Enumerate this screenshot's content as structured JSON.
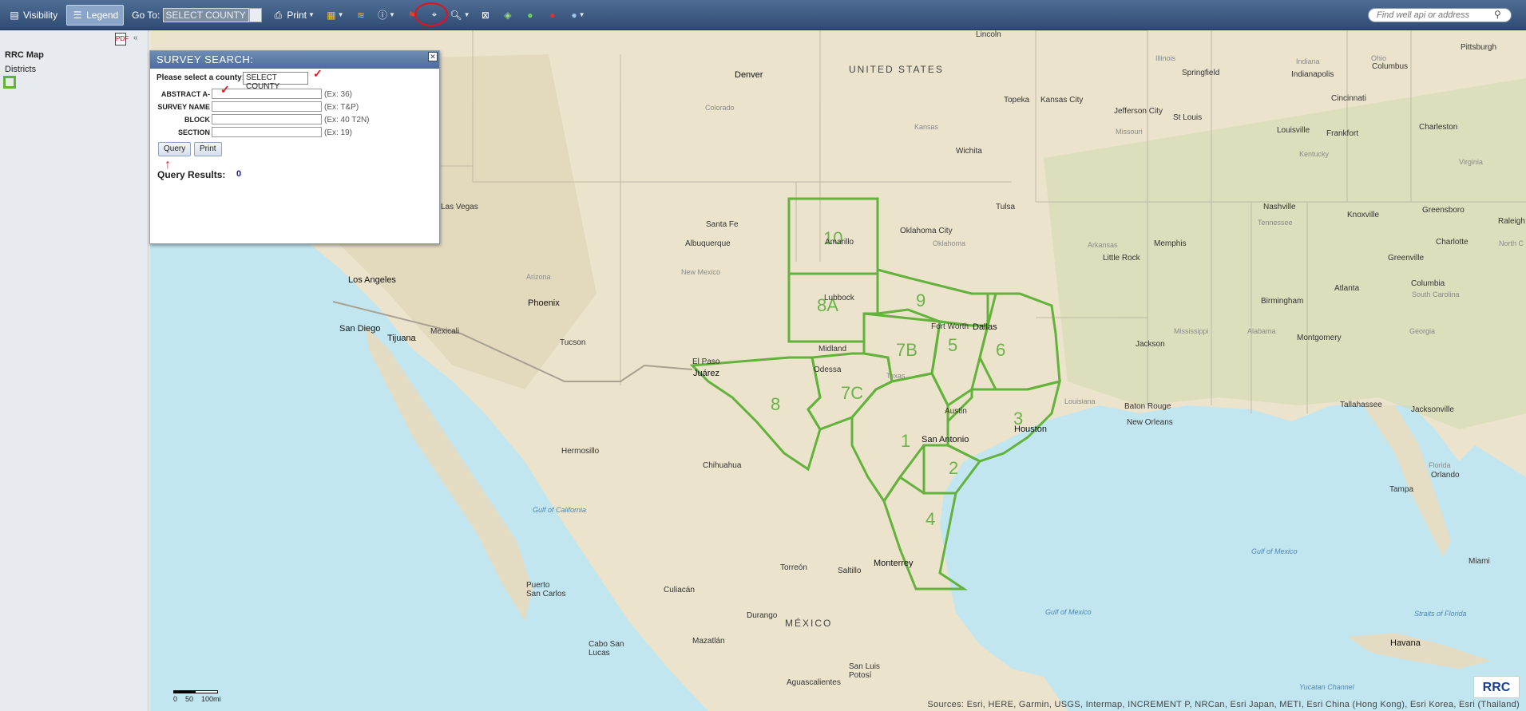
{
  "toolbar": {
    "visibility_label": "Visibility",
    "legend_label": "Legend",
    "goto_label": "Go To:",
    "goto_value": "SELECT COUNTY",
    "print_label": "Print",
    "search_placeholder": "Find well api or address"
  },
  "sidebar": {
    "title": "RRC Map",
    "layer_label": "Districts"
  },
  "dialog": {
    "title": "SURVEY SEARCH:",
    "county_prompt": "Please select a county:",
    "county_value": "SELECT COUNTY",
    "fields": [
      {
        "label": "ABSTRACT A-",
        "example": "(Ex: 36)"
      },
      {
        "label": "SURVEY NAME",
        "example": "(Ex: T&P)"
      },
      {
        "label": "BLOCK",
        "example": "(Ex: 40 T2N)"
      },
      {
        "label": "SECTION",
        "example": "(Ex: 19)"
      }
    ],
    "query_label": "Query",
    "print_label": "Print",
    "results_label": "Query Results:",
    "results_count": "0"
  },
  "map": {
    "attribution": "Sources: Esri, HERE, Garmin, USGS, Intermap, INCREMENT P, NRCan, Esri Japan, METI, Esri China (Hong Kong), Esri Korea, Esri (Thailand)",
    "scale_labels": [
      "0",
      "50",
      "100mi"
    ],
    "logo_text": "RRC",
    "district_color": "#63b23b",
    "districts": [
      "10",
      "9",
      "8A",
      "7B",
      "5",
      "6",
      "8",
      "7C",
      "3",
      "1",
      "2",
      "4"
    ],
    "places": {
      "lincoln": "Lincoln",
      "pittsburgh": "Pittsburgh",
      "denver": "Denver",
      "united_states": "UNITED STATES",
      "illinois": "Illinois",
      "springfield": "Springfield",
      "indiana": "Indiana",
      "indianapolis": "Indianapolis",
      "ohio": "Ohio",
      "columbus_oh": "Columbus",
      "colorado": "Colorado",
      "topeka": "Topeka",
      "kansas_city": "Kansas City",
      "jefferson_city": "Jefferson City",
      "missouri": "Missouri",
      "st_louis": "St Louis",
      "cincinnati": "Cincinnati",
      "kansas": "Kansas",
      "louisville": "Louisville",
      "frankfort": "Frankfort",
      "charleston": "Charleston",
      "kentucky": "Kentucky",
      "virginia": "Virginia",
      "wichita": "Wichita",
      "las_vegas": "Las Vegas",
      "tulsa": "Tulsa",
      "nashville": "Nashville",
      "tennessee": "Tennessee",
      "knoxville": "Knoxville",
      "greensboro": "Greensboro",
      "raleigh": "Raleigh",
      "santa_fe": "Santa Fe",
      "oklahoma_city": "Oklahoma City",
      "oklahoma": "Oklahoma",
      "arkansas": "Arkansas",
      "memphis": "Memphis",
      "charlotte": "Charlotte",
      "albuquerque": "Albuquerque",
      "amarillo": "Amarillo",
      "little_rock": "Little Rock",
      "greenville": "Greenville",
      "north_c": "North C",
      "los_angeles": "Los Angeles",
      "arizona": "Arizona",
      "new_mexico": "New Mexico",
      "atlanta": "Atlanta",
      "columbia": "Columbia",
      "south_carolina": "South Carolina",
      "lubbock": "Lubbock",
      "birmingham": "Birmingham",
      "phoenix": "Phoenix",
      "fort_worth": "Fort Worth",
      "dallas": "Dallas",
      "san_diego": "San Diego",
      "tijuana": "Tijuana",
      "mexicali": "Mexicali",
      "georgia": "Georgia",
      "alabama": "Alabama",
      "mississippi": "Mississippi",
      "montgomery": "Montgomery",
      "tucson": "Tucson",
      "jackson": "Jackson",
      "midland": "Midland",
      "el_paso": "El Paso",
      "juarez": "Juárez",
      "odessa": "Odessa",
      "texas": "Texas",
      "louisiana": "Louisiana",
      "baton_rouge": "Baton Rouge",
      "tallahassee": "Tallahassee",
      "jacksonville": "Jacksonville",
      "austin": "Austin",
      "houston": "Houston",
      "new_orleans": "New Orleans",
      "san_antonio": "San Antonio",
      "hermosillo": "Hermosillo",
      "chihuahua": "Chihuahua",
      "florida": "Florida",
      "orlando": "Orlando",
      "tampa": "Tampa",
      "gulf_california": "Gulf of California",
      "gulf_mexico": "Gulf of Mexico",
      "miami": "Miami",
      "torreon": "Torreón",
      "saltillo": "Saltillo",
      "monterrey": "Monterrey",
      "puerto_san_carlos": "Puerto San Carlos",
      "culiacan": "Culiacán",
      "durango": "Durango",
      "mexico": "MÉXICO",
      "gulf_mexico_2": "Gulf of Mexico",
      "straits_florida": "Straits of Florida",
      "cabo_san_lucas": "Cabo San Lucas",
      "mazatlan": "Mazatlán",
      "havana": "Havana",
      "san_luis_potosi": "San Luis Potosí",
      "aguascalientes": "Aguascalientes",
      "yucatan_channel": "Yucatan Channel"
    }
  }
}
